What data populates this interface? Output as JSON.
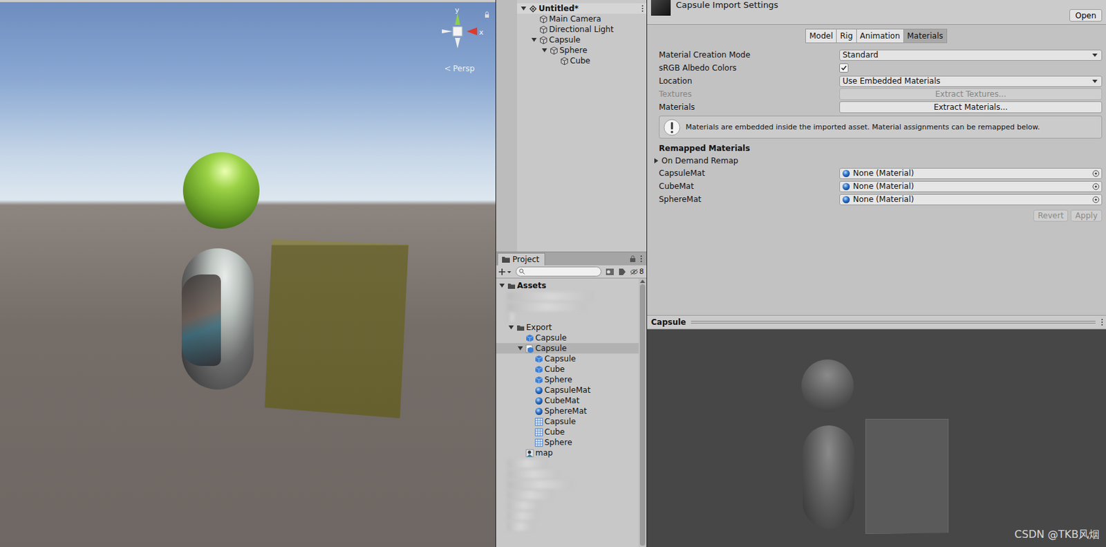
{
  "scene": {
    "gizmo": {
      "up_axis": "y",
      "side_axis": "x"
    },
    "projection": "Persp"
  },
  "hierarchy": {
    "items": [
      {
        "label": "Untitled*",
        "kind": "scene",
        "expanded": true,
        "children": [
          {
            "label": "Main Camera",
            "kind": "object"
          },
          {
            "label": "Directional Light",
            "kind": "object"
          },
          {
            "label": "Capsule",
            "kind": "object",
            "expanded": true,
            "children": [
              {
                "label": "Sphere",
                "kind": "object",
                "expanded": true,
                "children": [
                  {
                    "label": "Cube",
                    "kind": "object"
                  }
                ]
              }
            ]
          }
        ]
      }
    ]
  },
  "project": {
    "tab": "Project",
    "search": {
      "placeholder": ""
    },
    "hidden_count": "8",
    "tree": [
      {
        "label": "Assets",
        "kind": "folder",
        "expanded": true,
        "selected": false,
        "children": [
          {
            "kind": "blurred",
            "selected": false
          },
          {
            "kind": "blurred",
            "selected": false
          },
          {
            "kind": "blurred",
            "selected": false
          },
          {
            "label": "Export",
            "kind": "folder",
            "expanded": true,
            "selected": false,
            "children": [
              {
                "label": "Capsule",
                "kind": "prefab",
                "selected": false
              },
              {
                "label": "Capsule",
                "kind": "model",
                "expanded": true,
                "selected": true,
                "children": [
                  {
                    "label": "Capsule",
                    "kind": "prefab",
                    "selected": false
                  },
                  {
                    "label": "Cube",
                    "kind": "prefab",
                    "selected": false
                  },
                  {
                    "label": "Sphere",
                    "kind": "prefab",
                    "selected": false
                  },
                  {
                    "label": "CapsuleMat",
                    "kind": "material",
                    "selected": false
                  },
                  {
                    "label": "CubeMat",
                    "kind": "material",
                    "selected": false
                  },
                  {
                    "label": "SphereMat",
                    "kind": "material",
                    "selected": false
                  },
                  {
                    "label": "Capsule",
                    "kind": "mesh",
                    "selected": false
                  },
                  {
                    "label": "Cube",
                    "kind": "mesh",
                    "selected": false
                  },
                  {
                    "label": "Sphere",
                    "kind": "mesh",
                    "selected": false
                  }
                ]
              },
              {
                "label": "map",
                "kind": "texture",
                "selected": false
              }
            ]
          },
          {
            "kind": "blurred",
            "selected": false
          },
          {
            "kind": "blurred",
            "selected": false
          },
          {
            "kind": "blurred",
            "selected": false
          },
          {
            "kind": "blurred",
            "selected": false
          },
          {
            "kind": "blurred",
            "selected": false
          },
          {
            "kind": "blurred",
            "selected": false
          },
          {
            "kind": "blurred",
            "selected": false
          }
        ]
      }
    ]
  },
  "inspector": {
    "title": "Capsule Import Settings",
    "open_button": "Open",
    "tabs": [
      {
        "label": "Model",
        "selected": false
      },
      {
        "label": "Rig",
        "selected": false
      },
      {
        "label": "Animation",
        "selected": false
      },
      {
        "label": "Materials",
        "selected": true
      }
    ],
    "fields": [
      {
        "label": "Material Creation Mode",
        "kind": "dropdown",
        "value": "Standard",
        "disabled": false
      },
      {
        "label": "sRGB Albedo Colors",
        "kind": "checkbox",
        "checked": true,
        "disabled": false
      },
      {
        "label": "Location",
        "kind": "dropdown",
        "value": "Use Embedded Materials",
        "disabled": false
      },
      {
        "label": "Textures",
        "kind": "button",
        "value": "Extract Textures...",
        "disabled": true
      },
      {
        "label": "Materials",
        "kind": "button",
        "value": "Extract Materials...",
        "disabled": false
      }
    ],
    "info": "Materials are embedded inside the imported asset. Material assignments can be remapped below.",
    "remapped": {
      "title": "Remapped Materials",
      "on_demand": {
        "label": "On Demand Remap",
        "expanded": false
      },
      "items": [
        {
          "label": "CapsuleMat",
          "value": "None (Material)"
        },
        {
          "label": "CubeMat",
          "value": "None (Material)"
        },
        {
          "label": "SphereMat",
          "value": "None (Material)"
        }
      ]
    },
    "actions": [
      {
        "label": "Revert",
        "disabled": true
      },
      {
        "label": "Apply",
        "disabled": true
      }
    ]
  },
  "preview": {
    "title": "Capsule"
  },
  "watermark": "CSDN @TKB风烟"
}
